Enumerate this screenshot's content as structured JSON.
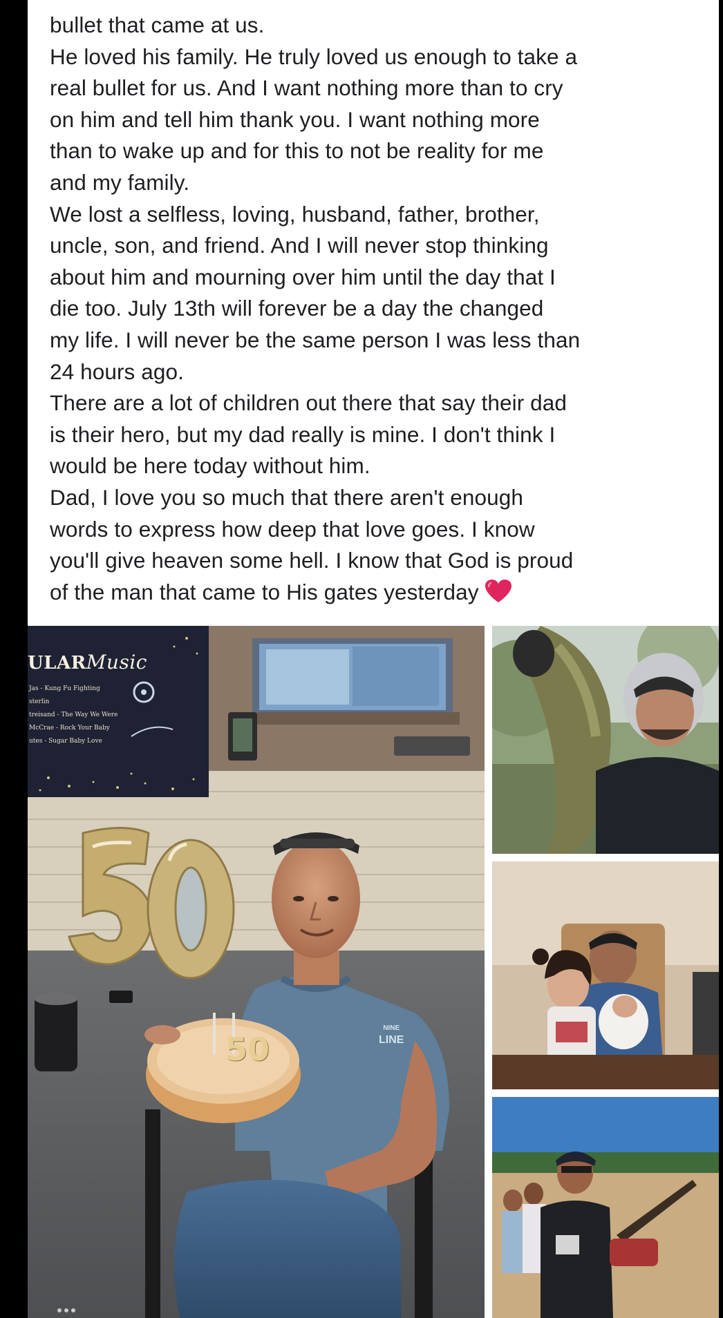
{
  "post": {
    "text_lines": [
      "bullet that came at us.",
      "He loved his family. He truly loved us enough to take a",
      "real bullet for us. And I want nothing more than to cry",
      "on him and tell him thank you. I want nothing more",
      "than to wake up and for this to not be reality for me",
      "and my family.",
      "We lost a selfless, loving, husband, father, brother,",
      "uncle, son, and friend. And I will never stop thinking",
      "about him and mourning over him until the day that I",
      "die too. July 13th will forever be a day the changed",
      "my life. I will never be the same person I was less than",
      "24 hours ago.",
      "There are a lot of children out there that say their dad",
      "is their hero, but my dad really is mine. I don't think I",
      "would be here today without him.",
      "Dad, I love you so much that there aren't enough",
      "words to express how deep that love goes. I know",
      "you'll give heaven some hell. I know that God is proud",
      "of the man that came to His gates yesterday"
    ],
    "end_emoji": "red-heart-icon"
  },
  "photos": {
    "main": {
      "poster_title": "ULAR",
      "poster_title_script": "Music",
      "poster_list": [
        "Jas - Kung Fu Fighting",
        "sterlin",
        "treisand - The Way We Were",
        "McCrae - Rock Your Baby",
        "utes - Sugar Baby Love"
      ],
      "balloon_number": "50",
      "cake_topper": "50",
      "shirt_logo_top": "NINE",
      "shirt_logo_bottom": "LINE"
    },
    "fish": {
      "subject": "man-holding-fish"
    },
    "family": {
      "subject": "father-with-children"
    },
    "field": {
      "subject": "group-in-field"
    }
  },
  "colors": {
    "page_bg": "#000000",
    "card_bg": "#ffffff",
    "text": "#1c1e21",
    "heart": "#e0245e"
  }
}
